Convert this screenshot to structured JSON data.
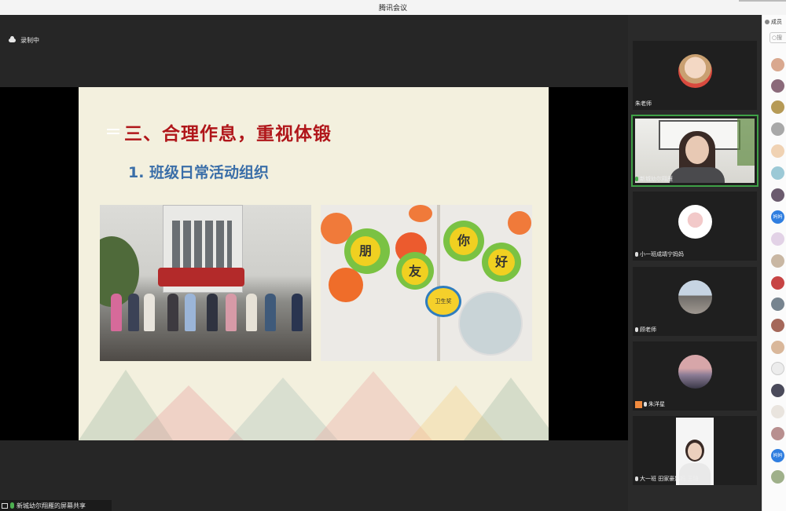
{
  "app": {
    "title": "腾讯会议"
  },
  "recording": {
    "label": "录制中"
  },
  "slide": {
    "title": "三、合理作息，重视体锻",
    "subtitle": "1. 班级日常活动组织",
    "photo2_chars": [
      "你",
      "朋",
      "友",
      "好"
    ],
    "badge": "卫生奖"
  },
  "share_status": {
    "label": "新城幼尔翔雁的屏幕共享"
  },
  "participants_panel": {
    "tiles": [
      {
        "name": "朱老师",
        "mic": "off"
      },
      {
        "name": "新城幼尔翔雁",
        "mic": "on"
      },
      {
        "name": "小一班成靖宁妈妈",
        "mic": "off"
      },
      {
        "name": "顾老师",
        "mic": "off"
      },
      {
        "name": "朱洋星",
        "mic": "off"
      },
      {
        "name": "大一班 田家豪妈妈 王琦",
        "mic": "off"
      }
    ]
  },
  "members_sidebar": {
    "header": "成员",
    "search_placeholder": "搜",
    "blue_avatars": [
      "妈妈",
      "妈妈"
    ]
  },
  "colors": {
    "accent_green": "#3fa046",
    "slide_title_red": "#b0161a",
    "slide_sub_blue": "#3a6ea8"
  }
}
